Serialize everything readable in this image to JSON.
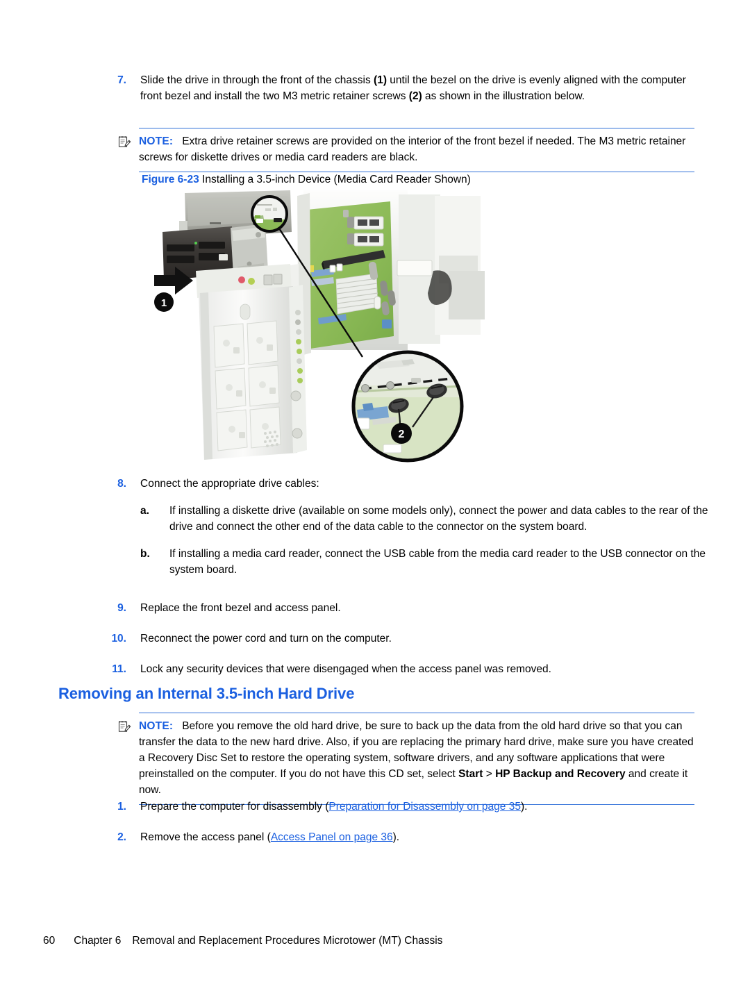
{
  "colors": {
    "accent_blue": "#1a5fe0",
    "note_rule": "#2f6fd8",
    "body_text": "#000000"
  },
  "steps_top": [
    {
      "number": "7.",
      "text_parts": [
        {
          "t": "Slide the drive in through the front of the chassis "
        },
        {
          "t": "(1)",
          "bold": true
        },
        {
          "t": " until the bezel on the drive is evenly aligned with the computer front bezel and install the two M3 metric retainer screws "
        },
        {
          "t": "(2)",
          "bold": true
        },
        {
          "t": " as shown in the illustration below."
        }
      ],
      "plain": "Slide the drive in through the front of the chassis (1) until the bezel on the drive is evenly aligned with the computer front bezel and install the two M3 metric retainer screws (2) as shown in the illustration below."
    }
  ],
  "note_1": {
    "icon": "note-pad-pencil-icon",
    "label": "NOTE:",
    "body": "Extra drive retainer screws are provided on the interior of the front bezel if needed. The M3 metric retainer screws for diskette drives or media card readers are black."
  },
  "figure": {
    "label": "Figure 6-23",
    "caption": "Installing a 3.5-inch Device (Media Card Reader Shown)",
    "alt": "Exploded illustration of a microtower chassis with a media card reader sliding into the front 3.5-inch bay, with a magnified inset showing two retainer screws.",
    "callouts": [
      {
        "id": "1",
        "meaning": "slide drive in through front of chassis"
      },
      {
        "id": "2",
        "meaning": "install the two M3 metric retainer screws"
      }
    ],
    "parts": {
      "optical_drive_label": "DVD",
      "card_reader_label": "media-card-reader",
      "motherboard_label": "system-board"
    }
  },
  "steps_mid": [
    {
      "number": "8.",
      "text": "Connect the appropriate drive cables:",
      "substeps": [
        {
          "number": "a.",
          "text": "If installing a diskette drive (available on some models only), connect the power and data cables to the rear of the drive and connect the other end of the data cable to the connector on the system board."
        },
        {
          "number": "b.",
          "text": "If installing a media card reader, connect the USB cable from the media card reader to the USB connector on the system board."
        }
      ]
    },
    {
      "number": "9.",
      "text": "Replace the front bezel and access panel."
    },
    {
      "number": "10.",
      "text": "Reconnect the power cord and turn on the computer."
    },
    {
      "number": "11.",
      "text": "Lock any security devices that were disengaged when the access panel was removed."
    }
  ],
  "section": {
    "title": "Removing an Internal 3.5-inch Hard Drive"
  },
  "note_2": {
    "icon": "note-pad-pencil-icon",
    "label": "NOTE:",
    "body_part_1": "Before you remove the old hard drive, be sure to back up the data from the old hard drive so that you can transfer the data to the new hard drive. Also, if you are replacing the primary hard drive, make sure you have created a Recovery Disc Set to restore the operating system, software drivers, and any software applications that were preinstalled on the computer. If you do not have this CD set, select ",
    "body_bold_1": "Start",
    "body_part_2": " > ",
    "body_bold_2": "HP Backup and Recovery",
    "body_part_3": " and create it now."
  },
  "steps_bottom": [
    {
      "number": "1.",
      "prefix": "Prepare the computer for disassembly (",
      "link": "Preparation for Disassembly on page 35",
      "suffix": ")."
    },
    {
      "number": "2.",
      "prefix": "Remove the access panel (",
      "link": "Access Panel on page 36",
      "suffix": ")."
    }
  ],
  "footer": {
    "page_number": "60",
    "chapter": "Chapter 6",
    "title": "Removal and Replacement Procedures Microtower (MT) Chassis"
  }
}
